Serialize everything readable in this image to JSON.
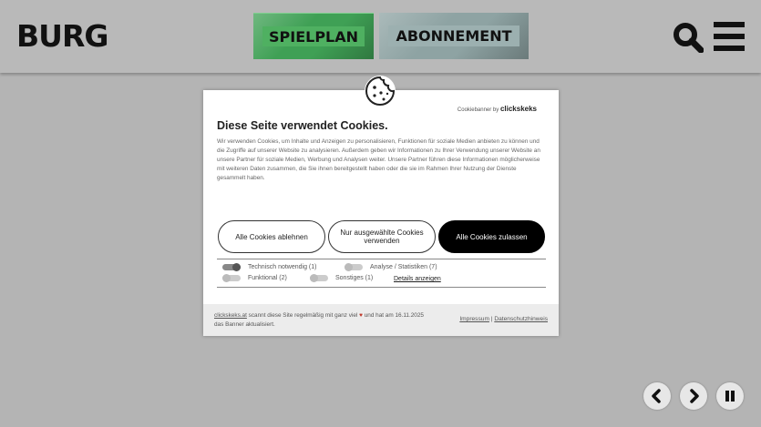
{
  "header": {
    "logo": "BURG",
    "nav": [
      {
        "label": "SPIELPLAN",
        "color": "#4fb061"
      },
      {
        "label": "ABONNEMENT",
        "color": "#9cb0b0"
      }
    ],
    "icons": [
      "search-icon",
      "menu-icon"
    ]
  },
  "cookie_banner": {
    "powered_prefix": "Cookiebanner by",
    "powered_brand": "clickskeks",
    "title": "Diese Seite verwendet Cookies.",
    "text": "Wir verwenden Cookies, um Inhalte und Anzeigen zu personalisieren, Funktionen für soziale Medien anbieten zu können und die Zugriffe auf unserer Website zu analysieren. Außerdem geben wir Informationen zu Ihrer Verwendung unserer Website an unsere Partner für soziale Medien, Werbung und Analysen weiter. Unsere Partner führen diese Informationen möglicherweise mit weiteren Daten zusammen, die Sie ihnen bereitgestellt haben oder die sie im Rahmen Ihrer Nutzung der Dienste gesammelt haben.",
    "buttons": {
      "reject": "Alle Cookies ablehnen",
      "selected": "Nur ausgewählte Cookies verwenden",
      "accept": "Alle Cookies zulassen"
    },
    "options": [
      {
        "label": "Technisch notwendig (1)",
        "on": true
      },
      {
        "label": "Analyse / Statistiken (7)",
        "on": false
      },
      {
        "label": "Funktional (2)",
        "on": false
      },
      {
        "label": "Sonstiges (1)",
        "on": false
      }
    ],
    "details_link": "Details anzeigen",
    "footer": {
      "link": "clickskeks.at",
      "text_a": " scannt diese Site regelmäßig mit ganz viel ",
      "text_b": " und hat am 16.11.2025 das Banner aktualisiert.",
      "impressum": "Impressum",
      "separator": "|",
      "datenschutz": "Datenschutzhinweis"
    }
  },
  "controls": [
    "chevron-left-icon",
    "chevron-right-icon",
    "pause-icon"
  ]
}
